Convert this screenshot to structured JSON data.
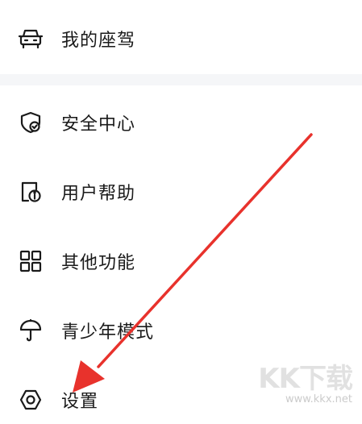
{
  "menu": {
    "items": [
      {
        "id": "my-seat",
        "label": "我的座驾",
        "icon": "car-icon"
      },
      {
        "id": "safety-center",
        "label": "安全中心",
        "icon": "shield-check-icon"
      },
      {
        "id": "user-help",
        "label": "用户帮助",
        "icon": "help-info-icon"
      },
      {
        "id": "other-functions",
        "label": "其他功能",
        "icon": "grid-icon"
      },
      {
        "id": "teen-mode",
        "label": "青少年模式",
        "icon": "umbrella-icon"
      },
      {
        "id": "settings",
        "label": "设置",
        "icon": "gear-hexagon-icon"
      }
    ]
  },
  "colors": {
    "text": "#1a1a1a",
    "separator": "#f5f6f8",
    "annotation_arrow": "#e8322c"
  },
  "watermark": {
    "logo": "KK下载",
    "url": "www.kkx.net"
  }
}
